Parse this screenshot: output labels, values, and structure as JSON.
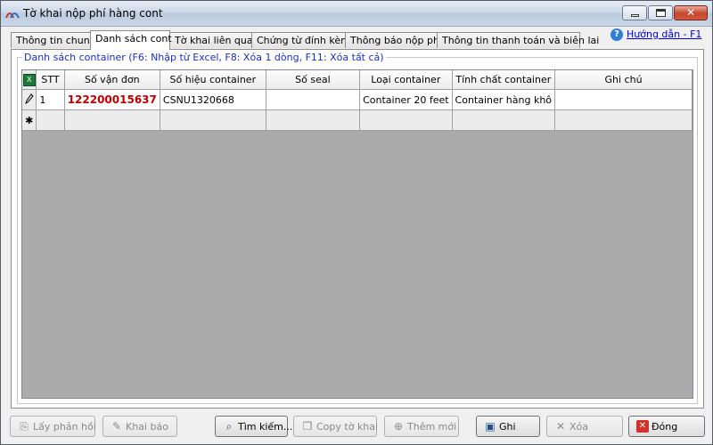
{
  "window": {
    "title": "Tờ khai nộp phí hàng cont"
  },
  "tabs": [
    {
      "label": "Thông tin chung"
    },
    {
      "label": "Danh sách cont"
    },
    {
      "label": "Tờ khai liên quan"
    },
    {
      "label": "Chứng từ đính kèm"
    },
    {
      "label": "Thông báo nộp phí"
    },
    {
      "label": "Thông tin thanh toán và biên lai"
    }
  ],
  "help": {
    "label": "Hướng dẫn - F1"
  },
  "group": {
    "legend": "Danh sách container (F6: Nhập từ Excel, F8: Xóa 1 dòng, F11: Xóa tất cả)"
  },
  "grid": {
    "columns": [
      "STT",
      "Số vận đơn",
      "Số hiệu container",
      "Số seal",
      "Loại container",
      "Tính chất container",
      "Ghi chú"
    ],
    "rows": [
      {
        "stt": "1",
        "so_van_don": "122200015637",
        "so_hieu": "CSNU1320668",
        "so_seal": "",
        "loai": "Container 20 feet",
        "tinh_chat": "Container hàng khô",
        "ghi_chu": ""
      }
    ]
  },
  "buttons": {
    "lay_phan_hoi": "Lấy phản hồi",
    "khai_bao": "Khai báo",
    "tim_kiem": "Tìm kiếm...",
    "copy_to_khai": "Copy tờ khai",
    "them_moi": "Thêm mới",
    "ghi": "Ghi",
    "xoa": "Xóa",
    "dong": "Đóng"
  },
  "icons": {
    "app": "app-logo-icon",
    "help": "help-icon",
    "excel": "excel-icon",
    "edit_row": "pencil-icon",
    "new_row": "asterisk-icon"
  },
  "colors": {
    "bill_number": "#c00000",
    "legend": "#1a2ecc",
    "link": "#0000ee"
  }
}
